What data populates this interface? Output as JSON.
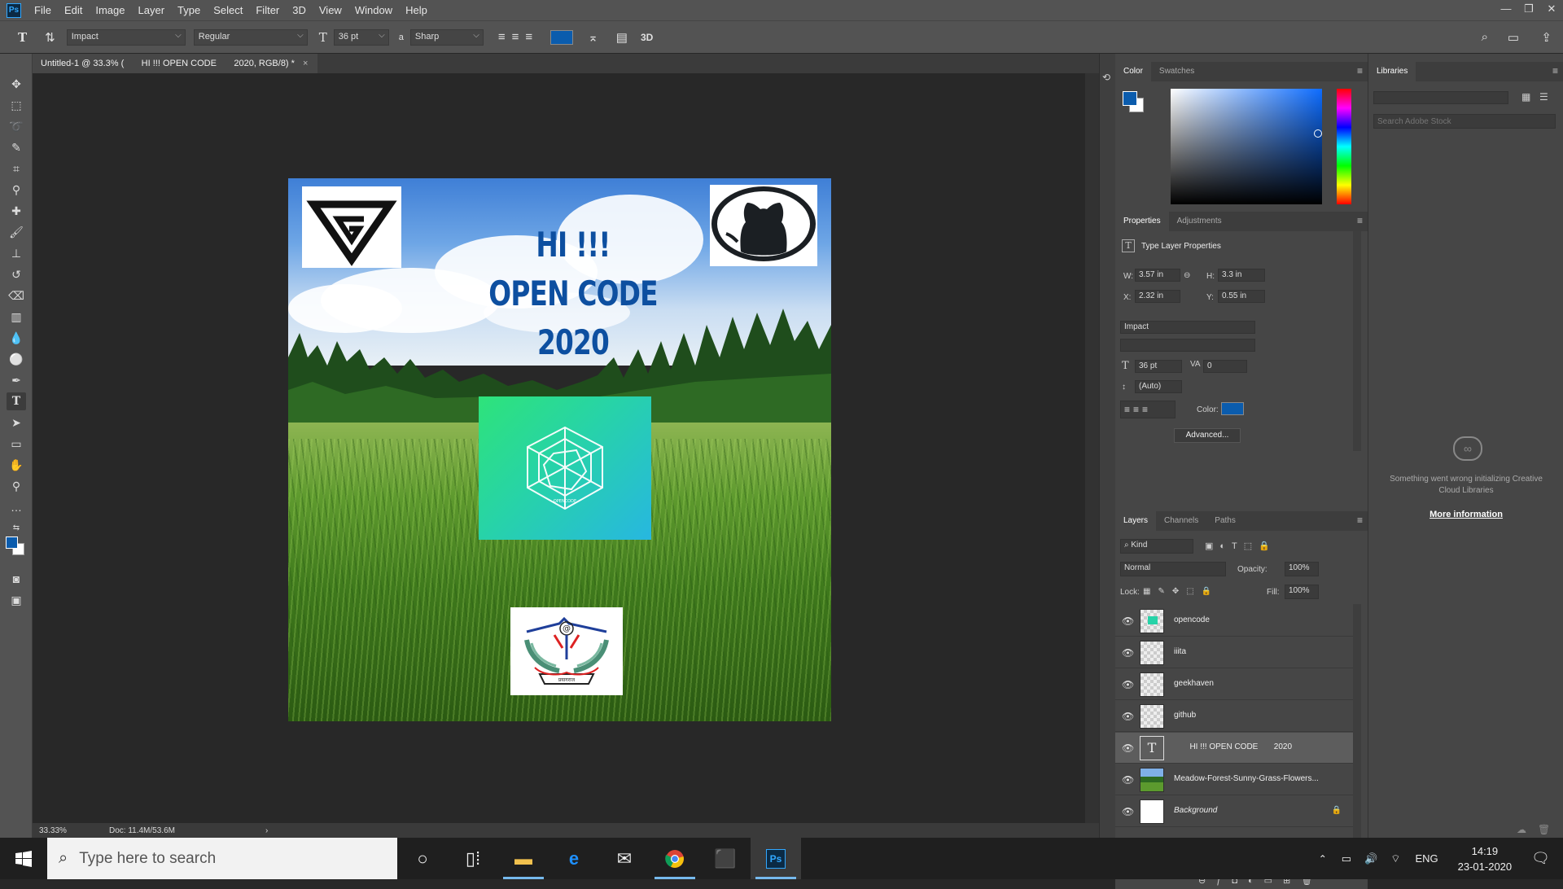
{
  "menubar": {
    "logo": "Ps",
    "items": [
      "File",
      "Edit",
      "Image",
      "Layer",
      "Type",
      "Select",
      "Filter",
      "3D",
      "View",
      "Window",
      "Help"
    ],
    "win": [
      "—",
      "❐",
      "✕"
    ]
  },
  "options": {
    "font_family": "Impact",
    "font_style": "Regular",
    "font_size": "36 pt",
    "antialias": "Sharp",
    "color": "#0b5cad",
    "three_d": "3D"
  },
  "document": {
    "tab_title": "Untitled-1 @ 33.3% (       HI !!! OPEN CODE       2020, RGB/8) *",
    "close": "×"
  },
  "poster": {
    "title_lines": [
      "HI !!!",
      "OPEN CODE",
      "2020"
    ],
    "geekhaven_logo": "G",
    "center_caption": "OPENCODE",
    "iiita_motto": "प्रयागराज"
  },
  "status": {
    "zoom": "33.33%",
    "doc": "Doc: 11.4M/53.6M",
    "arrow": "›"
  },
  "color_panel": {
    "tabs": [
      "Color",
      "Swatches"
    ],
    "fg": "#0b5cad"
  },
  "properties": {
    "tabs": [
      "Properties",
      "Adjustments"
    ],
    "header": "Type Layer Properties",
    "w_label": "W:",
    "w": "3.57 in",
    "h_label": "H:",
    "h": "3.3 in",
    "x_label": "X:",
    "x": "2.32 in",
    "y_label": "Y:",
    "y": "0.55 in",
    "font": "Impact",
    "size": "36 pt",
    "tracking": "0",
    "leading": "(Auto)",
    "color_label": "Color:",
    "advanced": "Advanced..."
  },
  "layers": {
    "tabs": [
      "Layers",
      "Channels",
      "Paths"
    ],
    "filter": "Kind",
    "blend": "Normal",
    "opacity_label": "Opacity:",
    "opacity": "100%",
    "lock_label": "Lock:",
    "fill_label": "Fill:",
    "fill": "100%",
    "rows": [
      {
        "name": "opencode"
      },
      {
        "name": "iiita"
      },
      {
        "name": "geekhaven"
      },
      {
        "name": "github"
      },
      {
        "name": "       HI !!! OPEN CODE       2020"
      },
      {
        "name": "Meadow-Forest-Sunny-Grass-Flowers..."
      },
      {
        "name": "Background"
      }
    ]
  },
  "libraries": {
    "tab": "Libraries",
    "search_placeholder": "Search Adobe Stock",
    "error": "Something went wrong initializing Creative Cloud Libraries",
    "more": "More information"
  },
  "taskbar": {
    "search": "Type here to search",
    "lang": "ENG",
    "time": "14:19",
    "date": "23-01-2020"
  }
}
